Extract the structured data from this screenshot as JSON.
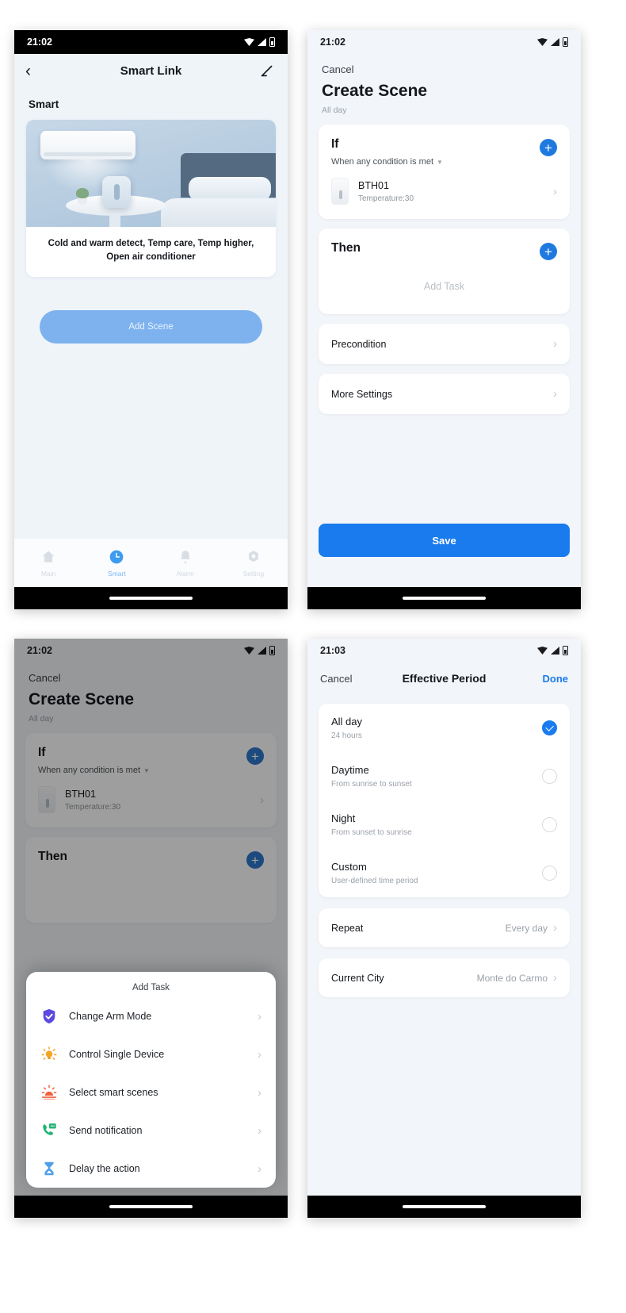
{
  "screen1": {
    "status": {
      "time": "21:02"
    },
    "nav": {
      "title": "Smart Link",
      "back_icon": "chevron-left-icon",
      "edit_icon": "pencil-icon"
    },
    "section_title": "Smart",
    "scene": {
      "caption": "Cold and warm detect, Temp care, Temp higher, Open air conditioner"
    },
    "add_scene_label": "Add Scene",
    "tabs": [
      {
        "label": "Main",
        "icon": "home-icon",
        "active": false
      },
      {
        "label": "Smart",
        "icon": "clock-icon",
        "active": true
      },
      {
        "label": "Alarm",
        "icon": "bell-icon",
        "active": false
      },
      {
        "label": "Setting",
        "icon": "gear-icon",
        "active": false
      }
    ]
  },
  "screen2": {
    "status": {
      "time": "21:02"
    },
    "cancel_label": "Cancel",
    "title": "Create Scene",
    "subtitle": "All day",
    "if_card": {
      "heading": "If",
      "condition_mode": "When any condition is met",
      "device": {
        "name": "BTH01",
        "detail": "Temperature:30"
      }
    },
    "then_card": {
      "heading": "Then",
      "empty_label": "Add Task"
    },
    "links": [
      {
        "label": "Precondition"
      },
      {
        "label": "More Settings"
      }
    ],
    "save_label": "Save"
  },
  "screen3": {
    "status": {
      "time": "21:02"
    },
    "cancel_label": "Cancel",
    "title": "Create Scene",
    "subtitle": "All day",
    "if_card": {
      "heading": "If",
      "condition_mode": "When any condition is met",
      "device": {
        "name": "BTH01",
        "detail": "Temperature:30"
      }
    },
    "then_heading": "Then",
    "sheet": {
      "title": "Add Task",
      "items": [
        {
          "label": "Change Arm Mode",
          "icon": "shield-check-icon",
          "color": "#5a4ade"
        },
        {
          "label": "Control Single Device",
          "icon": "light-bulb-icon",
          "color": "#f5a623"
        },
        {
          "label": "Select smart scenes",
          "icon": "sunrise-icon",
          "color": "#f0603c"
        },
        {
          "label": "Send notification",
          "icon": "phone-message-icon",
          "color": "#22b573"
        },
        {
          "label": "Delay the action",
          "icon": "hourglass-icon",
          "color": "#4f9fe8"
        }
      ]
    }
  },
  "screen4": {
    "status": {
      "time": "21:03"
    },
    "nav": {
      "cancel": "Cancel",
      "title": "Effective Period",
      "done": "Done"
    },
    "options": [
      {
        "title": "All day",
        "subtitle": "24 hours",
        "selected": true
      },
      {
        "title": "Daytime",
        "subtitle": "From sunrise to sunset",
        "selected": false
      },
      {
        "title": "Night",
        "subtitle": "From sunset to sunrise",
        "selected": false
      },
      {
        "title": "Custom",
        "subtitle": "User-defined time period",
        "selected": false
      }
    ],
    "settings": [
      {
        "key": "Repeat",
        "value": "Every day"
      },
      {
        "key": "Current City",
        "value": "Monte do Carmo"
      }
    ]
  },
  "theme": {
    "accent": "#1a7bee",
    "accent_light": "#7db2ef",
    "page_bg": "#f2f5f9"
  }
}
